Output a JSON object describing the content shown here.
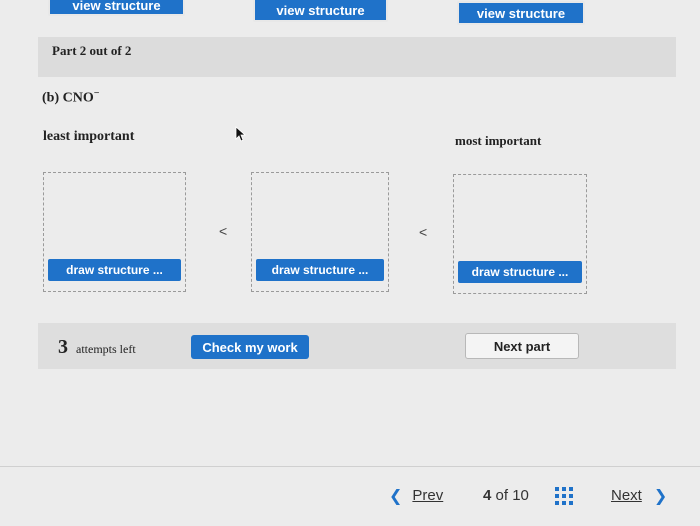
{
  "top_buttons": [
    "view structure",
    "view structure",
    "view structure"
  ],
  "part": {
    "label": "Part 2 out of 2"
  },
  "question": {
    "label": "(b) CNO",
    "superscript": "−"
  },
  "ranking": {
    "least_label": "least important",
    "most_label": "most important",
    "separator": "<",
    "draw_buttons": [
      "draw structure ...",
      "draw structure ...",
      "draw structure ..."
    ]
  },
  "actions": {
    "attempts_count": "3",
    "attempts_text": "attempts left",
    "check_label": "Check my work",
    "next_part_label": "Next part"
  },
  "pager": {
    "prev_label": "Prev",
    "page_current": "4",
    "page_of": "of",
    "page_total": "10",
    "next_label": "Next"
  },
  "colors": {
    "accent": "#1f72c9"
  }
}
